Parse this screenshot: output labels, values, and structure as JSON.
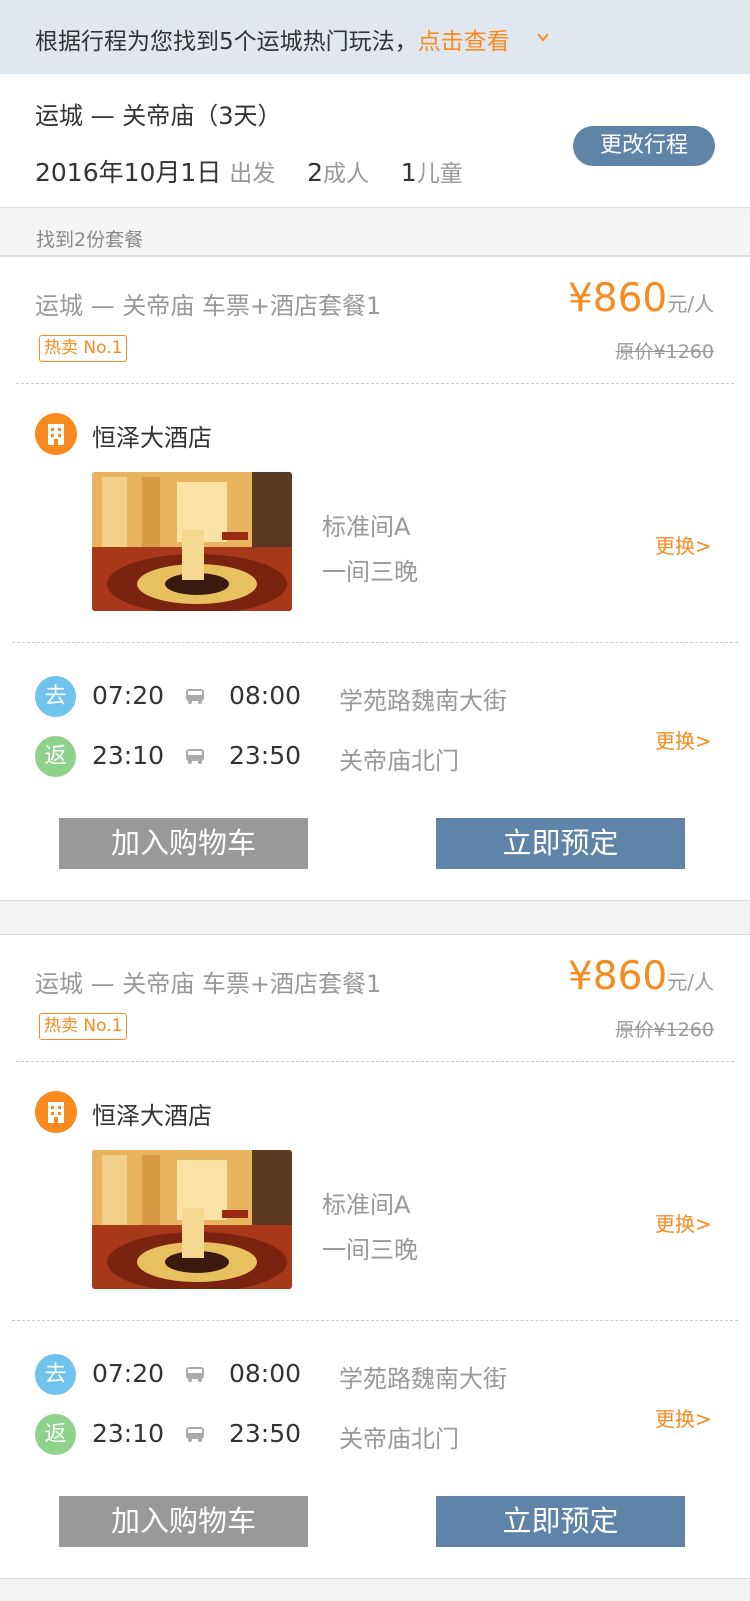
{
  "banner": {
    "text": "根据行程为您找到5个运城热门玩法，",
    "link": "点击查看",
    "chevron_icon": "chevron-down-icon"
  },
  "route": {
    "title": "运城 — 关帝庙（3天）",
    "date": "2016年10月1日",
    "depart_label": "出发",
    "adults_count": "2",
    "adults_label": "成人",
    "children_count": "1",
    "children_label": "儿童",
    "change_button": "更改行程"
  },
  "found_label": "找到2份套餐",
  "cards": [
    {
      "title": "运城 — 关帝庙 车票+酒店套餐1",
      "hot_badge": "热卖 No.1",
      "price": "¥860",
      "price_unit": "元/人",
      "original_price": "原价¥1260",
      "hotel_icon": "hotel-building-icon",
      "hotel_name": "恒泽大酒店",
      "room_type": "标准间A",
      "room_nights": "一间三晚",
      "swap_hotel_label": "更换>",
      "go_badge": "去",
      "go_depart": "07:20",
      "go_arrive": "08:00",
      "go_place": "学苑路魏南大街",
      "back_badge": "返",
      "back_depart": "23:10",
      "back_arrive": "23:50",
      "back_place": "关帝庙北门",
      "bus_icon": "bus-icon",
      "swap_trip_label": "更换>",
      "cart_button": "加入购物车",
      "book_button": "立即预定"
    },
    {
      "title": "运城 — 关帝庙 车票+酒店套餐1",
      "hot_badge": "热卖 No.1",
      "price": "¥860",
      "price_unit": "元/人",
      "original_price": "原价¥1260",
      "hotel_icon": "hotel-building-icon",
      "hotel_name": "恒泽大酒店",
      "room_type": "标准间A",
      "room_nights": "一间三晚",
      "swap_hotel_label": "更换>",
      "go_badge": "去",
      "go_depart": "07:20",
      "go_arrive": "08:00",
      "go_place": "学苑路魏南大街",
      "back_badge": "返",
      "back_depart": "23:10",
      "back_arrive": "23:50",
      "back_place": "关帝庙北门",
      "bus_icon": "bus-icon",
      "swap_trip_label": "更换>",
      "cart_button": "加入购物车",
      "book_button": "立即预定"
    }
  ],
  "colors": {
    "accent_orange": "#f78b1f",
    "primary_blue": "#5f84a8",
    "go_badge": "#6fc3ec",
    "back_badge": "#8ed28c"
  }
}
